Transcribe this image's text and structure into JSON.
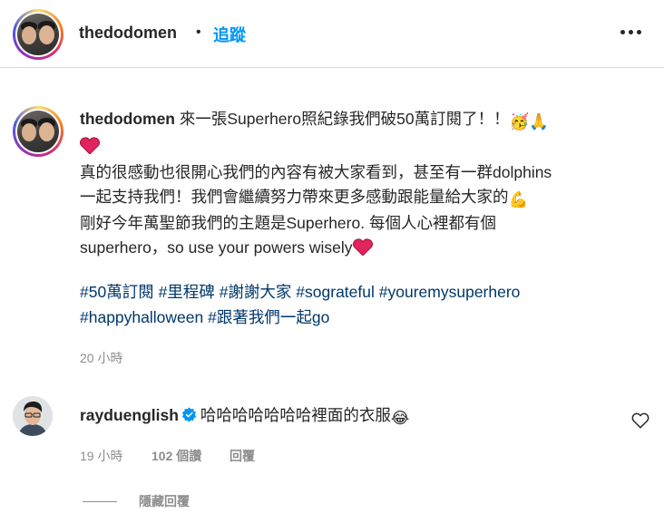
{
  "header": {
    "username": "thedodomen",
    "separator": "•",
    "follow_label": "追蹤",
    "more_icon": "more-horizontal-icon"
  },
  "caption": {
    "username": "thedodomen",
    "line1": "來一張Superhero照紀錄我們破50萬訂閱了！！",
    "emoji1": "🥳",
    "emoji2": "🙏",
    "line2": "真的很感動也很開心我們的內容有被大家看到，甚至有一群dolphins",
    "line3": "一起支持我們！我們會繼續努力帶來更多感動跟能量給大家的",
    "emoji3": "💪",
    "line4": "剛好今年萬聖節我們的主題是Superhero. 每個人心裡都有個",
    "line5": "superhero，so use your powers wisely",
    "hashtags": [
      "#50萬訂閱",
      "#里程碑",
      "#謝謝大家",
      "#sograteful",
      "#youremysuperhero",
      "#happyhalloween",
      "#跟著我們一起go"
    ],
    "time": "20 小時"
  },
  "comment": {
    "username": "rayduenglish",
    "text": "哈哈哈哈哈哈哈裡面的衣服",
    "emoji": "😂",
    "time": "19 小時",
    "likes": "102 個讚",
    "reply_label": "回覆",
    "hide_replies_label": "隱藏回覆"
  },
  "colors": {
    "link_blue": "#0095f6",
    "hashtag_blue": "#00376b",
    "muted": "#8e8e8e",
    "verified_blue": "#0095f6",
    "heart_red": "#ed4956"
  }
}
